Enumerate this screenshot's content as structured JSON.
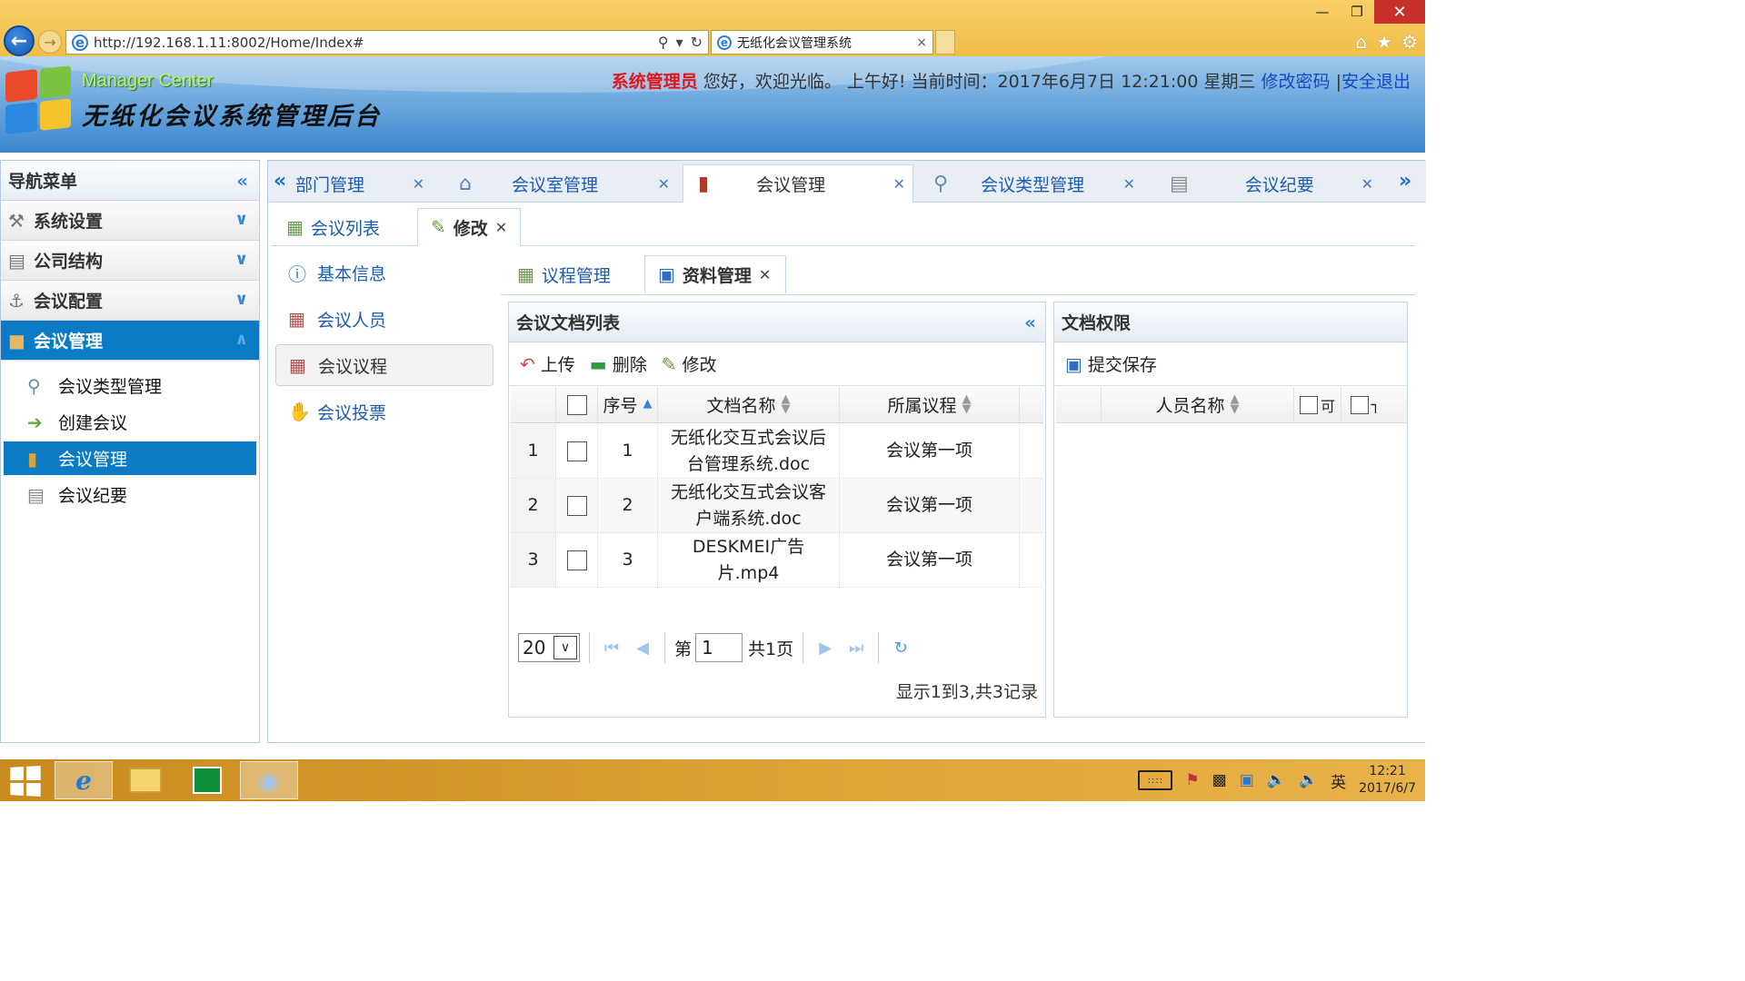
{
  "browser": {
    "url": "http://192.168.1.11:8002/Home/Index#",
    "tab_title": "无纸化会议管理系统",
    "tab_close": "×"
  },
  "header": {
    "brand_en": "Manager Center",
    "brand_cn": "无纸化会议系统管理后台",
    "user_role": "系统管理员",
    "greeting": "您好，欢迎光临。 上午好! 当前时间：2017年6月7日 12:21:00 星期三",
    "change_password": "修改密码",
    "separator": "|",
    "logout": "安全退出"
  },
  "sidebar": {
    "title": "导航菜单",
    "sections": [
      {
        "label": "系统设置"
      },
      {
        "label": "公司结构"
      },
      {
        "label": "会议配置"
      },
      {
        "label": "会议管理"
      }
    ],
    "items": [
      {
        "label": "会议类型管理"
      },
      {
        "label": "创建会议"
      },
      {
        "label": "会议管理"
      },
      {
        "label": "会议纪要"
      }
    ]
  },
  "main_tabs": [
    {
      "label": "部门管理"
    },
    {
      "label": "会议室管理"
    },
    {
      "label": "会议管理"
    },
    {
      "label": "会议类型管理"
    },
    {
      "label": "会议纪要"
    }
  ],
  "sub_tabs": [
    {
      "label": "会议列表"
    },
    {
      "label": "修改"
    }
  ],
  "left_menu": [
    {
      "label": "基本信息"
    },
    {
      "label": "会议人员"
    },
    {
      "label": "会议议程"
    },
    {
      "label": "会议投票"
    }
  ],
  "doc_tabs": [
    {
      "label": "议程管理"
    },
    {
      "label": "资料管理"
    }
  ],
  "doc_panel": {
    "title": "会议文档列表",
    "toolbar": {
      "upload": "上传",
      "delete": "删除",
      "edit": "修改"
    },
    "columns": {
      "index": "序号",
      "name": "文档名称",
      "agenda": "所属议程"
    },
    "rows": [
      {
        "rownum": "1",
        "index": "1",
        "name_line1": "无纸化交互式会议后",
        "name_line2": "台管理系统.doc",
        "agenda": "会议第一项"
      },
      {
        "rownum": "2",
        "index": "2",
        "name_line1": "无纸化交互式会议客",
        "name_line2": "户端系统.doc",
        "agenda": "会议第一项"
      },
      {
        "rownum": "3",
        "index": "3",
        "name_line1": "DESKMEI广告",
        "name_line2": "片.mp4",
        "agenda": "会议第一项"
      }
    ],
    "pager": {
      "page_size": "20",
      "page_prefix": "第",
      "page_value": "1",
      "page_total": "共1页",
      "info": "显示1到3,共3记录"
    }
  },
  "perm_panel": {
    "title": "文档权限",
    "save": "提交保存",
    "col_name": "人员名称",
    "col_a": "可",
    "col_b": "┐"
  },
  "taskbar": {
    "ime": "英",
    "time": "12:21",
    "date": "2017/6/7"
  },
  "colors": {
    "accent": "#0c7bc6",
    "link": "#1c5cb0",
    "admin_red": "#e0161a",
    "taskbar": "#dfa336"
  }
}
